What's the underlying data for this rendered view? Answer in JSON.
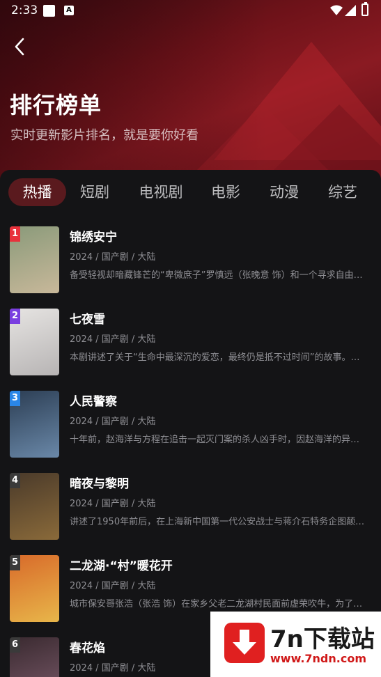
{
  "statusbar": {
    "time": "2:33",
    "a_badge": "A"
  },
  "header": {
    "title": "排行榜单",
    "subtitle": "实时更新影片排名，就是要你好看"
  },
  "tabs": [
    {
      "label": "热播",
      "active": true
    },
    {
      "label": "短剧",
      "active": false
    },
    {
      "label": "电视剧",
      "active": false
    },
    {
      "label": "电影",
      "active": false
    },
    {
      "label": "动漫",
      "active": false
    },
    {
      "label": "综艺",
      "active": false
    }
  ],
  "items": [
    {
      "rank": "1",
      "rank_color": "#e8323c",
      "name": "锦绣安宁",
      "meta": "2024 / 国产剧 / 大陆",
      "desc": "备受轻视却暗藏锋芒的“卑微庶子”罗慎远（张晚意 饰）和一个寻求自由…",
      "poster_colors": [
        "#8a9a7a",
        "#c8b89a"
      ]
    },
    {
      "rank": "2",
      "rank_color": "#7a3ee0",
      "name": "七夜雪",
      "meta": "2024 / 国产剧 / 大陆",
      "desc": "本剧讲述了关于“生命中最深沉的爱恋，最终仍是抵不过时间”的故事。…",
      "poster_colors": [
        "#e6e4e2",
        "#b7b4b4"
      ]
    },
    {
      "rank": "3",
      "rank_color": "#2a86e8",
      "name": "人民警察",
      "meta": "2024 / 国产剧 / 大陆",
      "desc": "十年前，赵海洋与方程在追击一起灭门案的杀人凶手时，因赵海洋的异…",
      "poster_colors": [
        "#2c3e54",
        "#6a88a8"
      ]
    },
    {
      "rank": "4",
      "rank_color": "#3a3a3a",
      "name": "暗夜与黎明",
      "meta": "2024 / 国产剧 / 大陆",
      "desc": "讲述了1950年前后，在上海新中国第一代公安战士与蒋介石特务企图颠…",
      "poster_colors": [
        "#4a3a2a",
        "#8a6a3a"
      ]
    },
    {
      "rank": "5",
      "rank_color": "#3a3a3a",
      "name": "二龙湖·“村”暖花开",
      "meta": "2024 / 国产剧 / 大陆",
      "desc": "城市保安哥张浩（张浩 饰）在家乡父老二龙湖村民面前虚荣吹牛，为了…",
      "poster_colors": [
        "#d86a2a",
        "#e8b64a"
      ]
    },
    {
      "rank": "6",
      "rank_color": "#3a3a3a",
      "name": "春花焰",
      "meta": "2024 / 国产剧 / 大陆",
      "desc": "",
      "poster_colors": [
        "#3a2a30",
        "#7a5a6a"
      ]
    }
  ],
  "watermark": {
    "brand": "7n下载站",
    "url": "www.7ndn.com"
  }
}
